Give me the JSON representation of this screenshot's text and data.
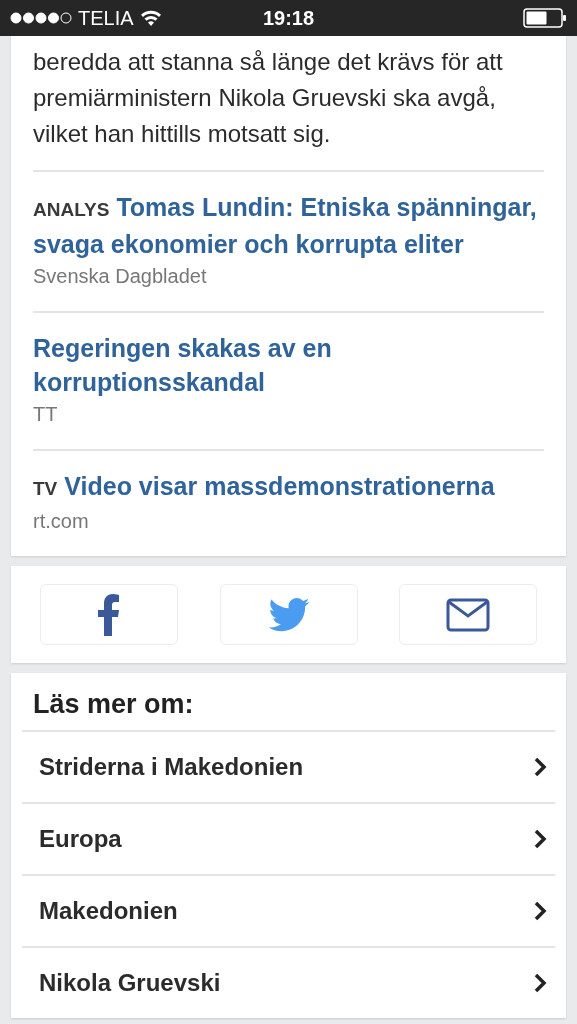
{
  "status_bar": {
    "carrier": "TELIA",
    "time": "19:18"
  },
  "article": {
    "paragraph": "beredda att stanna så länge det krävs för att premiärministern Nikola Gruevski ska avgå, vilket han hittills motsatt sig."
  },
  "related_links": [
    {
      "label": "ANALYS",
      "title": "Tomas Lundin: Etniska spänningar, svaga ekonomier och korrupta eliter",
      "source": "Svenska Dagbladet"
    },
    {
      "title": "Regeringen skakas av en korruptionsskandal",
      "source": "TT"
    },
    {
      "label": "TV",
      "title": "Video visar massdemonstrationerna",
      "source": "rt.com"
    }
  ],
  "share_buttons": [
    {
      "kind": "facebook"
    },
    {
      "kind": "twitter"
    },
    {
      "kind": "email"
    }
  ],
  "read_more": {
    "heading": "Läs mer om:",
    "topics": [
      "Striderna i Makedonien",
      "Europa",
      "Makedonien",
      "Nikola Gruevski"
    ]
  }
}
